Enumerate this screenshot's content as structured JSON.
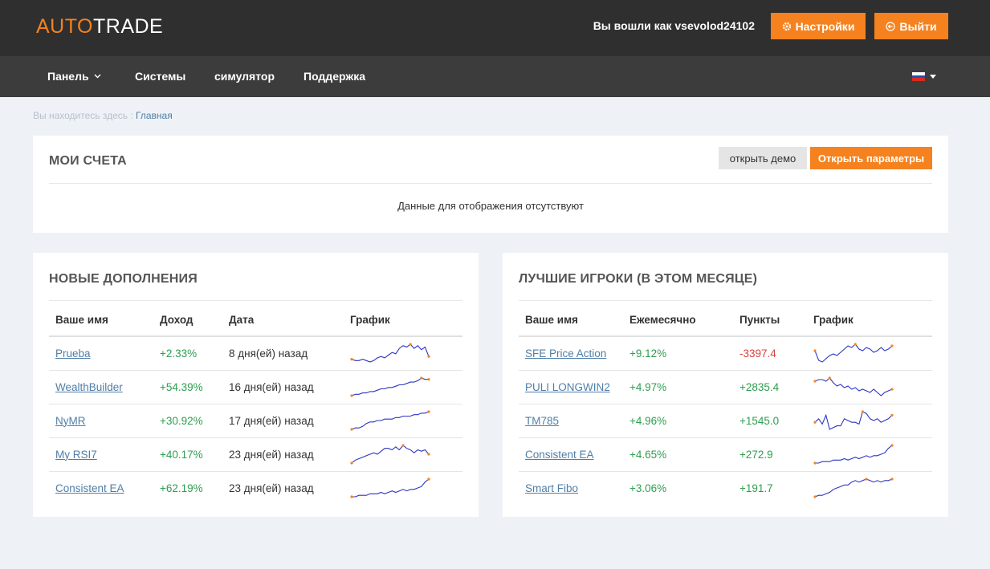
{
  "header": {
    "logo_a": "AUTO",
    "logo_b": "TRADE",
    "logged_in": "Вы вошли как vsevolod24102",
    "settings_label": "Настройки",
    "logout_label": "Выйти"
  },
  "nav": {
    "items": [
      "Панель",
      "Системы",
      "симулятор",
      "Поддержка"
    ]
  },
  "breadcrumb": {
    "prefix": "Вы находитесь здесь :",
    "current": "Главная"
  },
  "accounts": {
    "title": "МОИ СЧЕТА",
    "demo_label": "открыть демо",
    "params_label": "Открыть параметры",
    "empty": "Данные для отображения отсутствуют"
  },
  "new_additions": {
    "title": "НОВЫЕ ДОПОЛНЕНИЯ",
    "columns": [
      "Ваше имя",
      "Доход",
      "Дата",
      "График"
    ],
    "rows": [
      {
        "name": "Prueba",
        "income": "+2.33%",
        "date": "8 дня(ей) назад",
        "spark": [
          4,
          3,
          3,
          4,
          3,
          2,
          3,
          5,
          6,
          5,
          7,
          9,
          8,
          12,
          14,
          13,
          15,
          12,
          14,
          11,
          13,
          6
        ]
      },
      {
        "name": "WealthBuilder",
        "income": "+54.39%",
        "date": "16 дня(ей) назад",
        "spark": [
          2,
          3,
          3,
          4,
          4,
          5,
          5,
          6,
          7,
          7,
          8,
          8,
          9,
          10,
          10,
          11,
          12,
          12,
          13,
          15,
          14,
          14
        ]
      },
      {
        "name": "NyMR",
        "income": "+30.92%",
        "date": "17 дня(ей) назад",
        "spark": [
          2,
          3,
          3,
          4,
          6,
          7,
          7,
          8,
          8,
          9,
          9,
          9,
          10,
          10,
          11,
          11,
          11,
          12,
          12,
          13,
          13,
          14
        ]
      },
      {
        "name": "My RSI7",
        "income": "+40.17%",
        "date": "23 дня(ей) назад",
        "spark": [
          3,
          5,
          6,
          7,
          8,
          9,
          10,
          9,
          11,
          13,
          13,
          12,
          14,
          12,
          15,
          13,
          12,
          10,
          12,
          11,
          12,
          9
        ]
      },
      {
        "name": "Consistent EA",
        "income": "+62.19%",
        "date": "23 дня(ей) назад",
        "spark": [
          2,
          2,
          3,
          3,
          3,
          4,
          4,
          4,
          5,
          4,
          5,
          6,
          5,
          6,
          7,
          6,
          7,
          7,
          8,
          9,
          12,
          14
        ]
      }
    ]
  },
  "top_players": {
    "title": "ЛУЧШИЕ ИГРОКИ (В ЭТОМ МЕСЯЦЕ)",
    "columns": [
      "Ваше имя",
      "Ежемесячно",
      "Пункты",
      "График"
    ],
    "rows": [
      {
        "name": "SFE Price Action",
        "monthly": "+9.12%",
        "points": "-3397.4",
        "points_neg": true,
        "spark": [
          10,
          4,
          3,
          5,
          7,
          8,
          7,
          9,
          11,
          13,
          12,
          14,
          11,
          10,
          12,
          11,
          9,
          10,
          12,
          10,
          11,
          13
        ]
      },
      {
        "name": "PULI LONGWIN2",
        "monthly": "+4.97%",
        "points": "+2835.4",
        "points_neg": false,
        "spark": [
          12,
          13,
          13,
          12,
          14,
          11,
          9,
          10,
          8,
          9,
          7,
          8,
          6,
          7,
          6,
          5,
          7,
          5,
          3,
          5,
          6,
          7
        ]
      },
      {
        "name": "TM785",
        "monthly": "+4.96%",
        "points": "+1545.0",
        "points_neg": false,
        "spark": [
          8,
          10,
          7,
          12,
          4,
          5,
          6,
          6,
          10,
          9,
          8,
          8,
          7,
          14,
          13,
          10,
          9,
          10,
          8,
          9,
          10,
          12
        ]
      },
      {
        "name": "Consistent EA",
        "monthly": "+4.65%",
        "points": "+272.9",
        "points_neg": false,
        "spark": [
          2,
          2,
          3,
          3,
          3,
          4,
          4,
          4,
          5,
          4,
          5,
          6,
          5,
          6,
          7,
          6,
          7,
          7,
          8,
          9,
          12,
          14
        ]
      },
      {
        "name": "Smart Fibo",
        "monthly": "+3.06%",
        "points": "+191.7",
        "points_neg": false,
        "spark": [
          2,
          3,
          3,
          4,
          5,
          7,
          8,
          9,
          10,
          10,
          12,
          13,
          12,
          13,
          14,
          13,
          12,
          13,
          12,
          13,
          13,
          14
        ]
      }
    ]
  },
  "colors": {
    "accent": "#f5821f",
    "topbar": "#2f2f2f",
    "navbar": "#3c3c3c",
    "positive": "#2e9e4f",
    "negative": "#d9413d",
    "spark_line": "#2a34c4",
    "spark_point": "#f5821f"
  }
}
